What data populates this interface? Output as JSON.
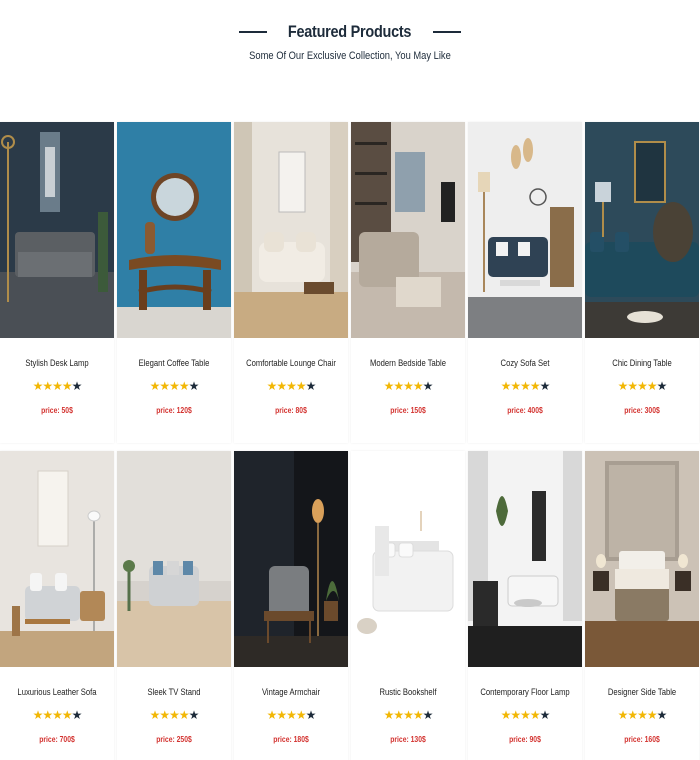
{
  "section": {
    "title": "Featured Products",
    "subtitle": "Some Of Our Exclusive Collection, You May Like"
  },
  "products": [
    {
      "name": "Stylish Desk Lamp",
      "rating": 4,
      "max_rating": 5,
      "price": "price: 50$"
    },
    {
      "name": "Elegant Coffee Table",
      "rating": 4,
      "max_rating": 5,
      "price": "price: 120$"
    },
    {
      "name": "Comfortable Lounge Chair",
      "rating": 4,
      "max_rating": 5,
      "price": "price: 80$"
    },
    {
      "name": "Modern Bedside Table",
      "rating": 4,
      "max_rating": 5,
      "price": "price: 150$"
    },
    {
      "name": "Cozy Sofa Set",
      "rating": 4,
      "max_rating": 5,
      "price": "price: 400$"
    },
    {
      "name": "Chic Dining Table",
      "rating": 4,
      "max_rating": 5,
      "price": "price: 300$"
    },
    {
      "name": "Luxurious Leather Sofa",
      "rating": 4,
      "max_rating": 5,
      "price": "price: 700$"
    },
    {
      "name": "Sleek TV Stand",
      "rating": 4,
      "max_rating": 5,
      "price": "price: 250$"
    },
    {
      "name": "Vintage Armchair",
      "rating": 4,
      "max_rating": 5,
      "price": "price: 180$"
    },
    {
      "name": "Rustic Bookshelf",
      "rating": 4,
      "max_rating": 5,
      "price": "price: 130$"
    },
    {
      "name": "Contemporary Floor Lamp",
      "rating": 4,
      "max_rating": 5,
      "price": "price: 90$"
    },
    {
      "name": "Designer Side Table",
      "rating": 4,
      "max_rating": 5,
      "price": "price: 160$"
    }
  ],
  "colors": {
    "star_filled": "#f2b705",
    "star_empty": "#1d2b3a",
    "price": "#d3322f",
    "title": "#1d2b3a"
  }
}
